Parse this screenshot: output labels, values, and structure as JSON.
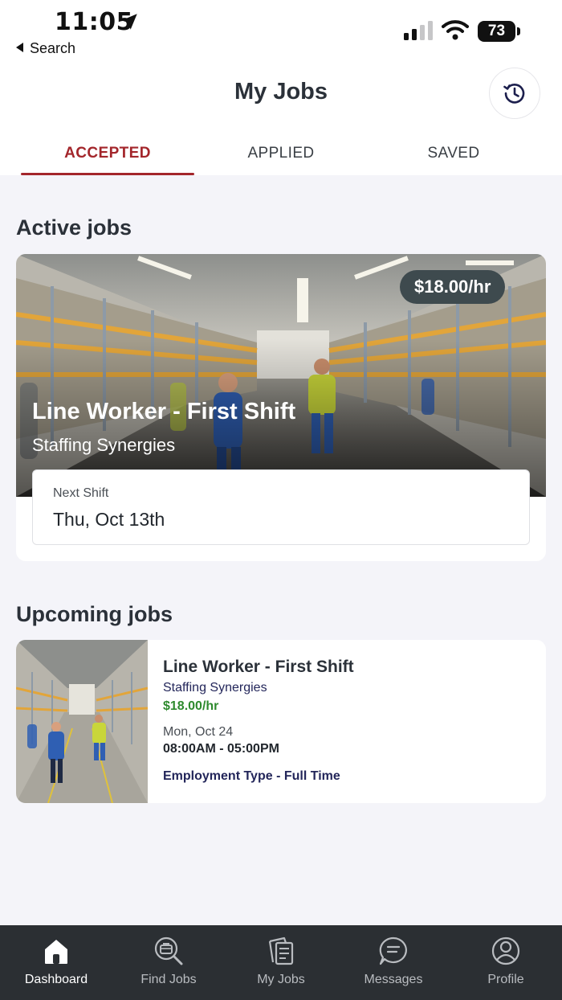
{
  "status_bar": {
    "time": "11:05",
    "back_label": "Search",
    "battery": "73"
  },
  "header": {
    "title": "My Jobs",
    "history_icon": "clock-history-icon",
    "tabs": [
      {
        "label": "ACCEPTED",
        "active": true
      },
      {
        "label": "APPLIED",
        "active": false
      },
      {
        "label": "SAVED",
        "active": false
      }
    ]
  },
  "active_jobs": {
    "section_title": "Active jobs",
    "card": {
      "rate": "$18.00/hr",
      "title": "Line Worker - First Shift",
      "company": "Staffing Synergies",
      "next_shift_label": "Next Shift",
      "next_shift_value": "Thu, Oct 13th"
    }
  },
  "upcoming_jobs": {
    "section_title": "Upcoming jobs",
    "card": {
      "title": "Line Worker - First Shift",
      "company": "Staffing Synergies",
      "rate": "$18.00/hr",
      "date": "Mon, Oct 24",
      "hours": "08:00AM - 05:00PM",
      "employment_type": "Employment Type - Full Time"
    }
  },
  "bottom_nav": {
    "items": [
      {
        "label": "Dashboard",
        "icon": "home-icon",
        "active": true
      },
      {
        "label": "Find Jobs",
        "icon": "briefcase-search-icon",
        "active": false
      },
      {
        "label": "My Jobs",
        "icon": "documents-icon",
        "active": false
      },
      {
        "label": "Messages",
        "icon": "chat-bubble-icon",
        "active": false
      },
      {
        "label": "Profile",
        "icon": "user-circle-icon",
        "active": false
      }
    ]
  },
  "colors": {
    "accent_red": "#a3262b",
    "rate_green": "#2e8a2e",
    "nav_background": "#2b2f33",
    "badge_background": "#3e4a4e"
  }
}
